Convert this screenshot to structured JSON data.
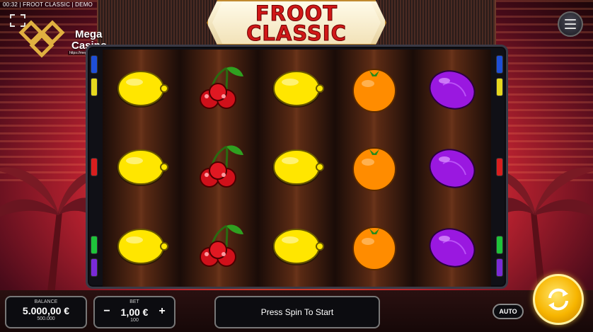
{
  "topbar": {
    "info": "00:32 | FROOT CLASSIC | DEMO"
  },
  "logo": {
    "line1": "Mega",
    "line2": "Casino",
    "url": "https://megacasino.casino/"
  },
  "title": {
    "line1": "FROOT",
    "line2": "CLASSIC"
  },
  "reels": [
    [
      "lemon",
      "lemon",
      "lemon"
    ],
    [
      "cherry",
      "cherry",
      "cherry"
    ],
    [
      "lemon",
      "lemon",
      "lemon"
    ],
    [
      "orange",
      "orange",
      "orange"
    ],
    [
      "plum",
      "plum",
      "plum"
    ]
  ],
  "payline_markers": {
    "left": [
      "#1e4fd8",
      "#e6d81e",
      "#d81e1e",
      "#1ec43a",
      "#7a2ad8"
    ],
    "right": [
      "#1e4fd8",
      "#e6d81e",
      "#d81e1e",
      "#1ec43a",
      "#7a2ad8"
    ]
  },
  "balance": {
    "label": "BALANCE",
    "value": "5.000,00 €",
    "sub": "500.000"
  },
  "bet": {
    "label": "BET",
    "minus": "−",
    "value": "1,00 €",
    "plus": "+",
    "sub": "100"
  },
  "status": {
    "message": "Press Spin To Start"
  },
  "auto": {
    "label": "AUTO"
  },
  "colors": {
    "accent_gold": "#f7b500",
    "title_red": "#d01818"
  }
}
